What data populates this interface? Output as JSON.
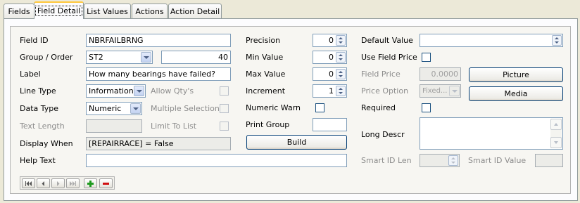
{
  "tabs": [
    {
      "label": "Fields",
      "active": false
    },
    {
      "label": "Field Detail",
      "active": true
    },
    {
      "label": "List Values",
      "active": false
    },
    {
      "label": "Actions",
      "active": false
    },
    {
      "label": "Action Detail",
      "active": false
    }
  ],
  "form": {
    "field_id": {
      "label": "Field ID",
      "value": "NBRFAILBRNG"
    },
    "group_order": {
      "label": "Group / Order",
      "group_value": "ST2",
      "order_value": "40"
    },
    "label_field": {
      "label": "Label",
      "value": "How many bearings have failed?"
    },
    "line_type": {
      "label": "Line Type",
      "value": "Information"
    },
    "allow_qtys": {
      "label": "Allow Qty's",
      "checked": false
    },
    "data_type": {
      "label": "Data Type",
      "value": "Numeric"
    },
    "multiple_selections": {
      "label": "Multiple Selections",
      "checked": false
    },
    "text_length": {
      "label": "Text Length",
      "value": ""
    },
    "limit_to_list": {
      "label": "Limit To List",
      "checked": false
    },
    "display_when": {
      "label": "Display When",
      "value": "[REPAIRRACE] = False"
    },
    "help_text": {
      "label": "Help Text",
      "value": ""
    },
    "precision": {
      "label": "Precision",
      "value": "0"
    },
    "min_value": {
      "label": "Min Value",
      "value": "0"
    },
    "max_value": {
      "label": "Max Value",
      "value": "0"
    },
    "increment": {
      "label": "Increment",
      "value": "1"
    },
    "numeric_warn": {
      "label": "Numeric Warn",
      "checked": false
    },
    "print_group": {
      "label": "Print Group",
      "value": ""
    },
    "build_button": "Build",
    "default_value": {
      "label": "Default Value",
      "value": ""
    },
    "use_field_price": {
      "label": "Use Field Price",
      "checked": false
    },
    "field_price": {
      "label": "Field Price",
      "value": "0.0000"
    },
    "picture_button": "Picture",
    "price_option": {
      "label": "Price Option",
      "value": "Fixed..."
    },
    "media_button": "Media",
    "required": {
      "label": "Required",
      "checked": false
    },
    "long_descr": {
      "label": "Long Descr",
      "value": ""
    },
    "smart_id_len": {
      "label": "Smart ID Len",
      "value": ""
    },
    "smart_id_value": {
      "label": "Smart ID Value",
      "value": ""
    }
  },
  "navigator": {
    "buttons": [
      "first-icon",
      "prev-icon",
      "next-icon",
      "last-icon",
      "add-icon",
      "delete-icon"
    ],
    "add_color": "#1f9a1f",
    "delete_color": "#d01010"
  }
}
